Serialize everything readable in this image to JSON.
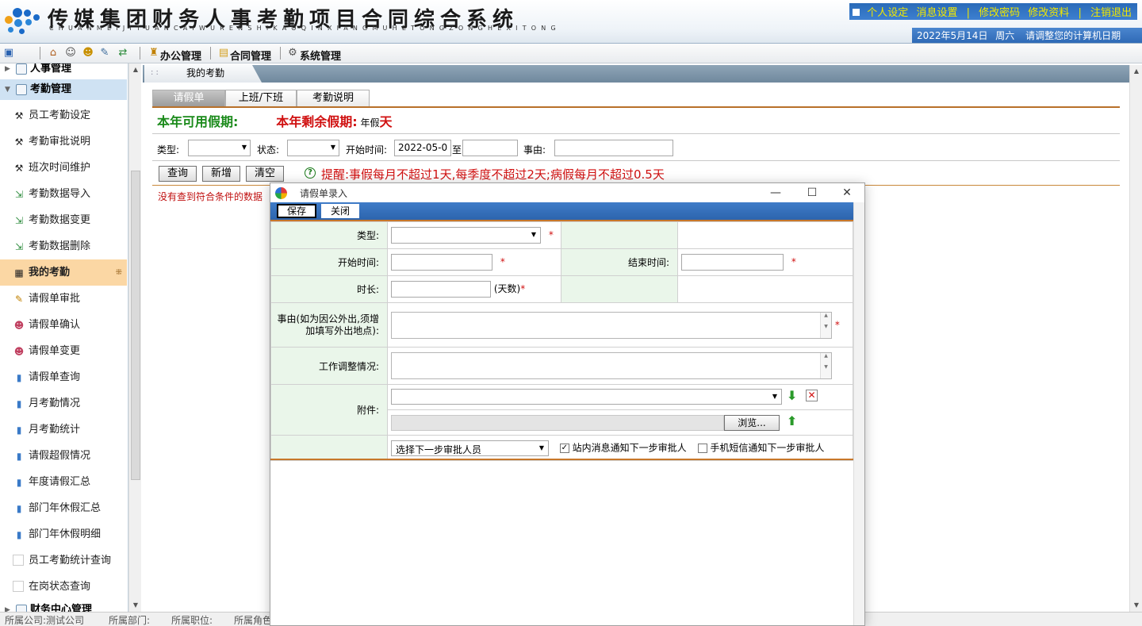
{
  "header": {
    "title": "传媒集团财务人事考勤项目合同综合系统",
    "pinyin": "CHUANMEIJITUANCAIWURENSHIKAOQINXIANGMUHETONGZONGHEXITONG",
    "links": [
      "个人设定",
      "消息设置",
      "修改密码",
      "修改资料",
      "注销退出"
    ],
    "date": "2022年5月14日",
    "weekday": "周六",
    "notice": "请调整您的计算机日期"
  },
  "toolbar": {
    "menus": [
      "办公管理",
      "合同管理",
      "系统管理"
    ]
  },
  "sidebar": {
    "group_hr": "人事管理",
    "group_attendance": "考勤管理",
    "items": [
      "员工考勤设定",
      "考勤审批说明",
      "班次时间维护",
      "考勤数据导入",
      "考勤数据变更",
      "考勤数据删除",
      "我的考勤",
      "请假单审批",
      "请假单确认",
      "请假单变更",
      "请假单查询",
      "月考勤情况",
      "月考勤统计",
      "请假超假情况",
      "年度请假汇总",
      "部门年休假汇总",
      "部门年休假明细",
      "员工考勤统计查询",
      "在岗状态查询"
    ],
    "group_finance": "财务中心管理"
  },
  "main": {
    "tab_label": "我的考勤",
    "subtabs": [
      "请假单",
      "上班/下班",
      "考勤说明"
    ],
    "available_leave_label": "本年可用假期:",
    "remaining_leave_label": "本年剩余假期:",
    "annual_leave_prefix": "年假",
    "annual_leave_unit": "天",
    "filter": {
      "type_label": "类型:",
      "status_label": "状态:",
      "start_label": "开始时间:",
      "start_value": "2022-05-0",
      "to_label": "至",
      "reason_label": "事由:"
    },
    "buttons": {
      "query": "查询",
      "add": "新增",
      "clear": "清空"
    },
    "reminder": "提醒:事假每月不超过1天,每季度不超过2天;病假每月不超过0.5天",
    "no_data": "没有查到符合条件的数据"
  },
  "statusbar": {
    "company": "所属公司:测试公司",
    "department": "所属部门:",
    "position": "所属职位:",
    "role": "所属角色"
  },
  "dialog": {
    "title": "请假单录入",
    "save": "保存",
    "close": "关闭",
    "type_label": "类型:",
    "start_label": "开始时间:",
    "end_label": "结束时间:",
    "duration_label": "时长:",
    "duration_unit": "(天数)",
    "reason_label": "事由(如为因公外出,须增加填写外出地点):",
    "work_adjust_label": "工作调整情况:",
    "attachment_label": "附件:",
    "browse": "浏览...",
    "approver_placeholder": "选择下一步审批人员",
    "notify_internal": "站内消息通知下一步审批人",
    "notify_sms": "手机短信通知下一步审批人",
    "notify_internal_checked": true,
    "notify_sms_checked": false
  },
  "colors": {
    "green_text": "#1a8a1a",
    "red_text": "#d01010",
    "dialog_toolbar": "#2c64ad",
    "active_sidebar": "#fbd7a4",
    "form_label_bg": "#eaf6ea"
  }
}
